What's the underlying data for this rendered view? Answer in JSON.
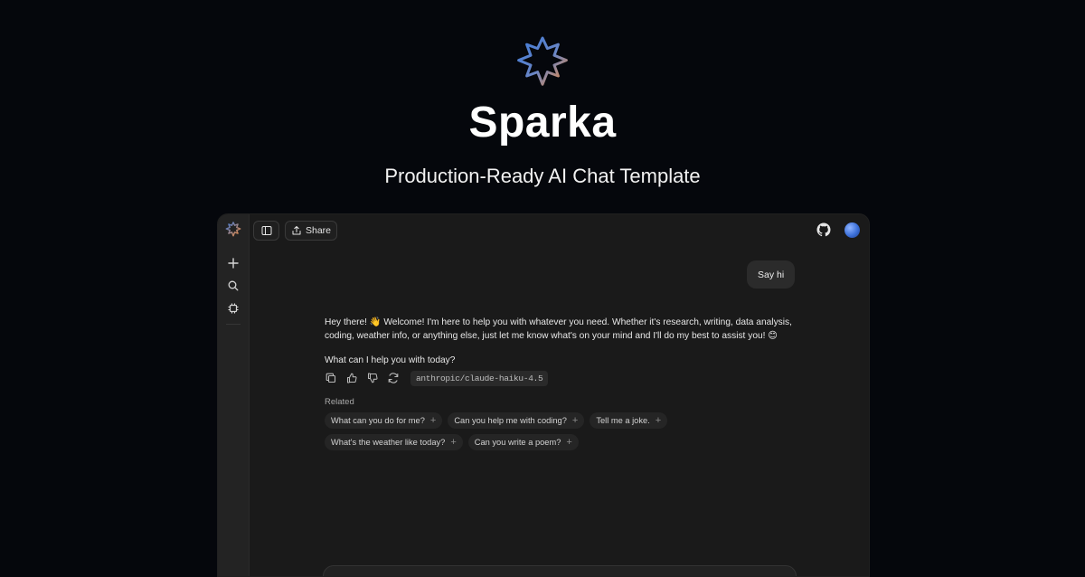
{
  "hero": {
    "title": "Sparka",
    "subtitle": "Production-Ready AI Chat Template",
    "logo_icon": "sparkle-badge-icon"
  },
  "colors": {
    "background": "#05070c",
    "app_background": "#1a1a1a",
    "logo_blue": "#3f7bd9",
    "logo_orange": "#f08a3c"
  },
  "topbar": {
    "share_label": "Share",
    "sidebar_toggle_icon": "sidebar-panel-icon",
    "github_icon": "github-icon",
    "avatar_icon": "avatar"
  },
  "rail": {
    "items": [
      {
        "icon": "plus-icon"
      },
      {
        "icon": "search-icon"
      },
      {
        "icon": "chip-icon"
      }
    ]
  },
  "chat": {
    "user_message": "Say hi",
    "assistant_paragraph_1": "Hey there! 👋 Welcome! I'm here to help you with whatever you need. Whether it's research, writing, data analysis, coding, weather info, or anything else, just let me know what's on your mind and I'll do my best to assist you! 😊",
    "assistant_paragraph_2": "What can I help you with today?",
    "model": "anthropic/claude-haiku-4.5",
    "action_icons": [
      "copy-icon",
      "thumbs-up-icon",
      "thumbs-down-icon",
      "retry-icon"
    ]
  },
  "related": {
    "label": "Related",
    "items": [
      "What can you do for me?",
      "Can you help me with coding?",
      "Tell me a joke.",
      "What's the weather like today?",
      "Can you write a poem?"
    ]
  }
}
